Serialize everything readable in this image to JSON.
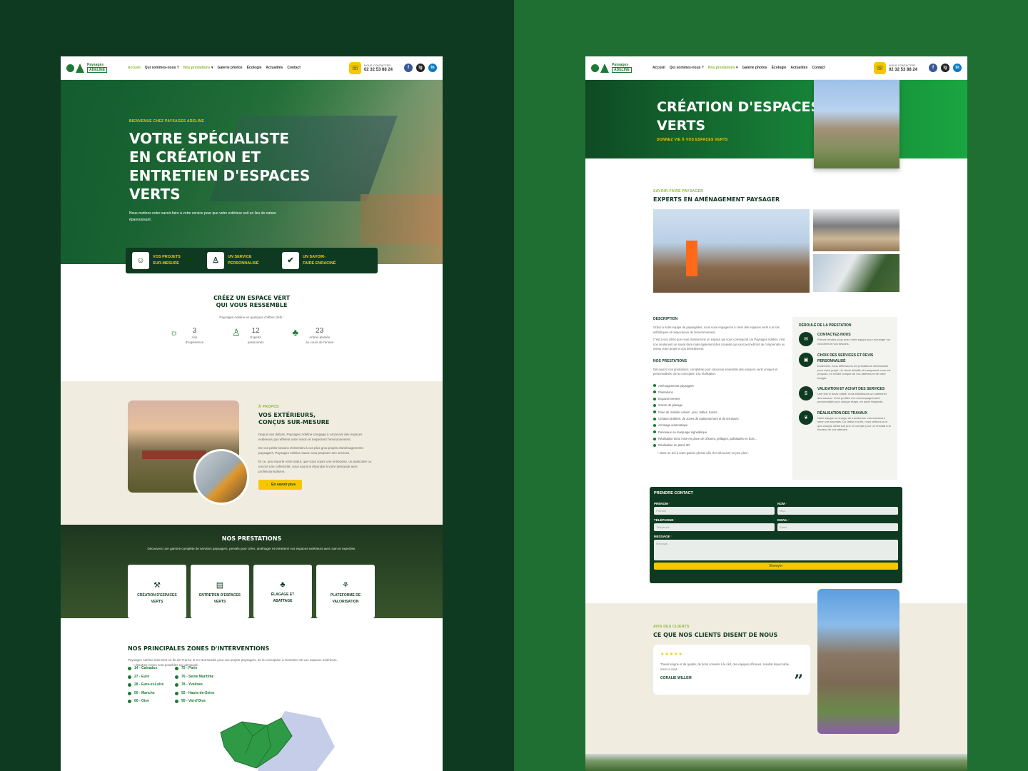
{
  "brand": {
    "name_top": "Paysages",
    "name_bottom": "ADELINE"
  },
  "nav": [
    "Accueil",
    "Qui sommes-nous ?",
    "Nos prestations",
    "Galerie photos",
    "Écologie",
    "Actualités",
    "Contact"
  ],
  "contact": {
    "label": "NOUS CONTACTER",
    "phone": "02 32 53 88 24"
  },
  "social": [
    "f",
    "ig",
    "in"
  ],
  "colors": {
    "dark_green": "#0f3a22",
    "green": "#1d7a34",
    "yellow": "#f6c700",
    "beige": "#f0ede0"
  },
  "home": {
    "hero": {
      "eyebrow": "BIENVENUE CHEZ PAYSAGES ADELINE",
      "title_lines": [
        "VOTRE SPÉCIALISTE",
        "EN CRÉATION ET",
        "ENTRETIEN D'ESPACES",
        "VERTS"
      ],
      "subtitle": "Nous mettons notre savoir-faire à votre service pour que votre extérieur soit un lieu de nature épanouissant."
    },
    "features": [
      {
        "icon": "person-icon",
        "label": "VOS PROJETS SUR-MESURE"
      },
      {
        "icon": "worker-icon",
        "label": "UN SERVICE PERSONNALISÉ"
      },
      {
        "icon": "shield-icon",
        "label": "UN SAVOIR-FAIRE ENRACINÉ"
      }
    ],
    "intro": {
      "title_lines": [
        "CRÉEZ UN ESPACE VERT",
        "QUI VOUS RESSEMBLE"
      ],
      "text": "Paysages Adeline en quelques chiffres clefs :",
      "stats": [
        {
          "icon": "bulb-icon",
          "value": "3",
          "label_lines": [
            "Ans",
            "d'expérience"
          ]
        },
        {
          "icon": "worker-icon",
          "value": "12",
          "label_lines": [
            "Experts",
            "passionnés"
          ]
        },
        {
          "icon": "tree-icon",
          "value": "23",
          "label_lines": [
            "Arbres plantés",
            "au cours de l'année"
          ]
        }
      ]
    },
    "about": {
      "eyebrow": "À PROPOS",
      "title_lines": [
        "VOS EXTÉRIEURS,",
        "CONÇUS SUR-MESURE"
      ],
      "paragraphs": [
        "Depuis ses débuts, Paysages Adeline s'engage à concevoir des espaces extérieurs qui reflètent votre vision et respectent l'environnement.",
        "De vos petits besoins d'entretien à vos plus gros projets d'aménagements paysagers, Paysages Adeline saura vous proposer ses services.",
        "Et ce, peu importe votre statut, que vous soyez une entreprise, un particulier ou encore une collectivité, nous saurons répondre à votre demande avec professionnalisme."
      ],
      "button": "En savoir plus"
    },
    "services": {
      "title": "NOS PRESTATIONS",
      "text": "Découvrez une gamme complète de services paysagers, pensés pour créer, aménager et entretenir vos espaces extérieurs avec soin et expertise.",
      "cards": [
        {
          "icon": "shovel-icon",
          "label_lines": [
            "CRÉATION D'ESPACES",
            "VERTS"
          ]
        },
        {
          "icon": "book-icon",
          "label_lines": [
            "ENTRETIEN D'ESPACES",
            "VERTS"
          ]
        },
        {
          "icon": "tree-icon",
          "label_lines": [
            "ÉLAGAGE ET",
            "ABATTAGE"
          ]
        },
        {
          "icon": "hand-plant-icon",
          "label_lines": [
            "PLATEFORME DE",
            "VALORISATION"
          ]
        }
      ]
    },
    "zones": {
      "title": "NOS PRINCIPALES ZONES D'INTERVENTIONS",
      "text": "Paysages Adeline intervient en Île-de-France et en Normandie pour vos projets paysagers, de la conception à l'entretien de vos espaces extérieurs.",
      "note": "D'autres zones sont possibles sur demande.",
      "list": [
        "14 - Calvados",
        "75 - Paris",
        "27 - Eure",
        "76 - Seine Maritime",
        "28 - Eure-et-Loire",
        "78 - Yvelines",
        "50 - Manche",
        "92 - Hauts-de-Seine",
        "60 - Oise",
        "95 - Val-d'Oise"
      ]
    }
  },
  "service_page": {
    "hero": {
      "title_lines": [
        "CRÉATION D'ESPACES",
        "VERTS"
      ],
      "subtitle": "DONNEZ VIE À VOS ESPACES VERTS"
    },
    "section": {
      "eyebrow": "SAVOIR-FAIRE PAYSAGER",
      "title": "EXPERTS EN AMÉNAGEMENT PAYSAGER"
    },
    "description": {
      "label": "DESCRIPTION",
      "paragraphs": [
        "Grâce à notre équipe de paysagistes, nous nous engageons à créer des espaces verts à la fois esthétiques et respectueux de l'environnement.",
        "C'est à vos côtés que nous dessinerons un espace qui vous correspond car Paysages Adeline c'est non seulement un savoir-faire mais également des conseils qui vous permettront de comprendre au mieux votre projet et son déroulement."
      ]
    },
    "prestations": {
      "label": "NOS PRESTATIONS",
      "text": "Découvrez nos prestations, complètes pour concevoir ensemble des espaces verts uniques et personnalisés, de la conception à la réalisation.",
      "list": [
        "Aménagements paysagers",
        "Plantations",
        "Engazonnement",
        "Gazon de placage",
        "Pose de mobilier urbain : jeux, tables, bancs...",
        "Création d'allées, de zones de stationnement et de terrasses",
        "Arrosage automatique",
        "Panneaux ou marquage signalétique",
        "Réalisation et/ou mise en place de clôtures, grillages, palissades en bois...",
        "Réalisation de plans 3D"
      ],
      "gallery_note": "Jetez un œil à notre galerie photos afin d'en découvrir un peu plus !"
    },
    "steps": {
      "title": "DÉROULÉ DE LA PRESTATION",
      "items": [
        {
          "icon": "chat-icon",
          "title": "CONTACTEZ-NOUS",
          "text": "Prenez rendez-vous avec notre équipe pour échanger sur vos idées et vos besoins."
        },
        {
          "icon": "wallet-icon",
          "title": "CHOIX DES SERVICES ET DEVIS PERSONNALISÉ",
          "text": "Ensemble, nous définissons les prestations nécessaires pour votre projet. Un devis détaillé et transparent vous est proposé, en tenant compte de vos attentes et de votre budget."
        },
        {
          "icon": "money-icon",
          "title": "VALIDATION ET ACHAT DES SERVICES",
          "text": "Une fois le devis validé, nous établissons un calendrier des travaux. Vous profitez d'un accompagnement personnalisé pour chaque étape, en toute simplicité."
        },
        {
          "icon": "leaf-icon",
          "title": "RÉALISATION DES TRAVAUX",
          "text": "Notre équipe se charge de transformer vos extérieurs selon vos souhaits. Du début à la fin, nous veillons à ce que chaque détail soit pris en compte pour un résultat à la hauteur de vos attentes."
        }
      ]
    },
    "form": {
      "title": "PRENDRE CONTACT",
      "fields": {
        "prenom": {
          "label": "PRÉNOM",
          "placeholder": "Prénom"
        },
        "nom": {
          "label": "NOM",
          "placeholder": "Nom"
        },
        "tel": {
          "label": "TÉLÉPHONE",
          "placeholder": "Téléphone"
        },
        "email": {
          "label": "EMAIL",
          "placeholder": "Email"
        },
        "message": {
          "label": "MESSAGE",
          "placeholder": "Message"
        }
      },
      "submit": "Envoyer"
    },
    "testimonials": {
      "eyebrow": "AVIS DES CLIENTS",
      "title": "CE QUE NOS CLIENTS DISENT DE NOUS",
      "rating": 5,
      "stars": "★★★★★",
      "quote": "Travail soigné et de qualité, de bons conseils à la clef, des équipes efficaces, résultat impeccable, merci à vous",
      "author": "CORALIE WILLEM"
    }
  }
}
